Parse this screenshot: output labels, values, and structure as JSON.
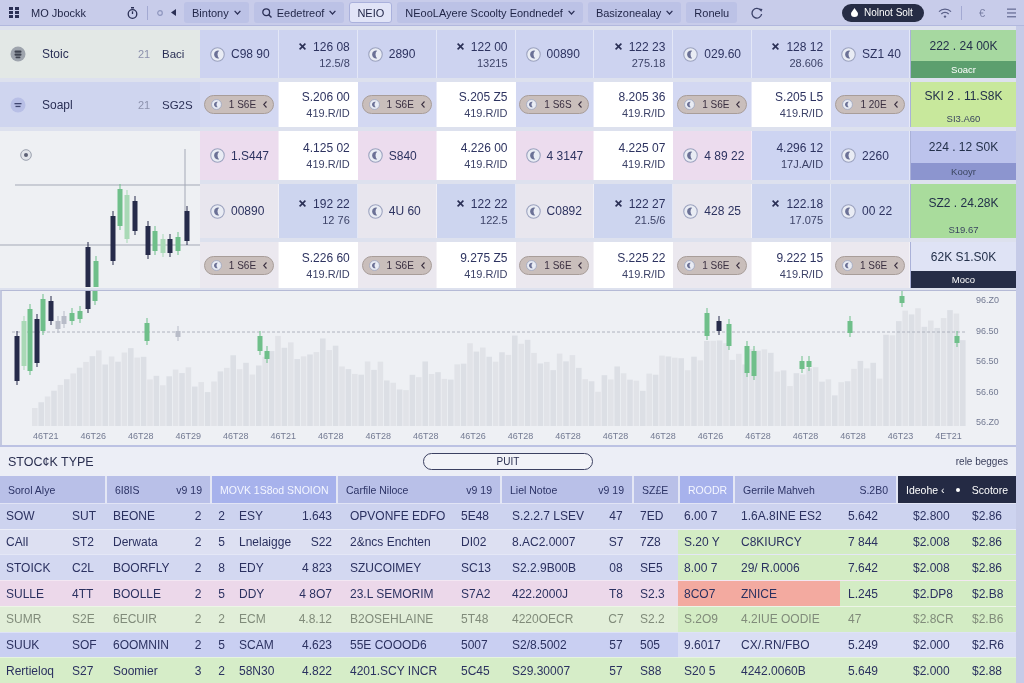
{
  "topbar": {
    "title": "MO Jbockk",
    "tabs": [
      {
        "label": "Bintony",
        "kind": "menu",
        "selected": false
      },
      {
        "label": "Eedetreof",
        "kind": "search",
        "selected": false
      },
      {
        "label": "NEIO",
        "kind": "plain",
        "selected": true
      },
      {
        "label": "NEooLAyere Scoolty Eondnedef",
        "kind": "menu",
        "selected": false
      },
      {
        "label": "Basizonealay",
        "kind": "menu",
        "selected": false
      },
      {
        "label": "Ronelu",
        "kind": "plain",
        "selected": false
      }
    ],
    "action_button": "Nolnot Solt",
    "currency": "€"
  },
  "watchlist": [
    {
      "name": "Stoic",
      "count": "21",
      "value": "Baci",
      "selected": false
    },
    {
      "name": "Soapl",
      "count": "21",
      "value": "SG2S",
      "selected": true
    }
  ],
  "quotes": [
    {
      "color": "#cdd3f0",
      "cells": [
        {
          "kind": "coin",
          "value": "C98 90"
        },
        {
          "kind": "marked",
          "value": "126 08",
          "sub": "12.5/8"
        },
        {
          "kind": "coin",
          "value": "2890"
        },
        {
          "kind": "marked",
          "value": "122 00",
          "sub": "13215"
        },
        {
          "kind": "coin",
          "value": "00890"
        },
        {
          "kind": "marked",
          "value": "122 23",
          "sub": "275.18"
        },
        {
          "kind": "coin",
          "value": "029.60"
        },
        {
          "kind": "marked",
          "value": "128 12",
          "sub": "28.606"
        },
        {
          "kind": "coin",
          "value": "SZ1 40"
        }
      ],
      "summary": {
        "value": "222 . 24 00K",
        "color": "#a6d8a0",
        "note": {
          "text": "Soacr",
          "color": "#5c9f6e"
        }
      }
    },
    {
      "color": "#d3d8f2",
      "cells": [
        {
          "kind": "pill",
          "value": "1 S6E"
        },
        {
          "kind": "price",
          "value": "S.206 00",
          "sub": "419.R/ID",
          "color": "#ffffff"
        },
        {
          "kind": "pill",
          "value": "1 S6E"
        },
        {
          "kind": "price",
          "value": "S.205 Z5",
          "sub": "419.R/ID",
          "color": "#ffffff"
        },
        {
          "kind": "pill",
          "value": "1 S6S"
        },
        {
          "kind": "price",
          "value": "8.205 36",
          "sub": "419.R/ID",
          "color": "#ffffff"
        },
        {
          "kind": "pill",
          "value": "1 S6E"
        },
        {
          "kind": "price",
          "value": "S.205 L5",
          "sub": "419.R/ID",
          "color": "#ffffff"
        },
        {
          "kind": "pill",
          "value": "1 20E"
        }
      ],
      "summary": {
        "value": "SKI 2 . 11.S8K",
        "color": "#c8e89c",
        "note": {
          "text": "SI3.A60",
          "color": "#c8e89c"
        }
      }
    },
    {
      "color": "#ecdcee",
      "cells": [
        {
          "kind": "coin",
          "value": "1.S447"
        },
        {
          "kind": "price",
          "value": "4.125 02",
          "sub": "419.R/ID",
          "color": "#ffffff"
        },
        {
          "kind": "coin",
          "value": "S840"
        },
        {
          "kind": "price",
          "value": "4.226 00",
          "sub": "419.R/ID",
          "color": "#ffffff"
        },
        {
          "kind": "coin",
          "value": "4 3147"
        },
        {
          "kind": "price",
          "value": "4.225 07",
          "sub": "419.R/ID",
          "color": "#ffffff"
        },
        {
          "kind": "coin",
          "value": "4 89 22"
        },
        {
          "kind": "price",
          "value": "4.296 12",
          "sub": "17J.A/ID",
          "color": "#cdd4f2"
        },
        {
          "kind": "coin",
          "value": "2260",
          "color": "#cdd4f2"
        }
      ],
      "summary": {
        "value": "224 . 12 S0K",
        "color": "#bcc3ec",
        "note": {
          "text": "Kooyr",
          "color": "#8c95cf"
        }
      }
    },
    {
      "color": "#e8e6ee",
      "cells": [
        {
          "kind": "coin",
          "value": "00890"
        },
        {
          "kind": "marked",
          "value": "192 22",
          "sub": "12 76",
          "color": "#cdd5ef"
        },
        {
          "kind": "coin",
          "value": "4U 60"
        },
        {
          "kind": "marked",
          "value": "122 22",
          "sub": "122.5",
          "color": "#cdd5ef"
        },
        {
          "kind": "coin",
          "value": "C0892"
        },
        {
          "kind": "marked",
          "value": "122 27",
          "sub": "21.5/6",
          "color": "#cdd5ef"
        },
        {
          "kind": "coin",
          "value": "428 25"
        },
        {
          "kind": "marked",
          "value": "122.18",
          "sub": "17.075",
          "color": "#cdd5ef"
        },
        {
          "kind": "coin",
          "value": "00 22",
          "color": "#cdd5ef"
        }
      ],
      "summary": {
        "value": "SZ2 . 24.28K",
        "color": "#a9dc9c",
        "note": {
          "text": "S19.67",
          "color": "#a9dc9c"
        }
      }
    },
    {
      "color": "#ebe8ef",
      "cells": [
        {
          "kind": "pill",
          "value": "1 S6E"
        },
        {
          "kind": "price",
          "value": "S.226 60",
          "sub": "419.R/ID",
          "color": "#ffffff"
        },
        {
          "kind": "pill",
          "value": "1 S6E"
        },
        {
          "kind": "price",
          "value": "9.275 Z5",
          "sub": "419.R/ID",
          "color": "#ffffff"
        },
        {
          "kind": "pill",
          "value": "1 S6E"
        },
        {
          "kind": "price",
          "value": "S.225 22",
          "sub": "419.R/ID",
          "color": "#ffffff"
        },
        {
          "kind": "pill",
          "value": "1 S6E"
        },
        {
          "kind": "price",
          "value": "9.222 15",
          "sub": "419.R/ID",
          "color": "#ffffff"
        },
        {
          "kind": "pill",
          "value": "1 S6E"
        }
      ],
      "summary": {
        "value": "62K S1.S0K",
        "color": "#dfe3f5",
        "note": {
          "text": "Moco",
          "color": "#262d47"
        }
      }
    }
  ],
  "chart": {
    "y_labels": [
      "96.Z0",
      "96.50",
      "56.50",
      "56.60",
      "56.Z0"
    ],
    "x_labels": [
      "46T21",
      "46T26",
      "46T28",
      "46T29",
      "46T28",
      "46T21",
      "46T28",
      "46T28",
      "46T28",
      "46T26",
      "46T28",
      "46T28",
      "46T28",
      "46T28",
      "46T26",
      "46T28",
      "46T28",
      "46T28",
      "46T23",
      "4ET21"
    ]
  },
  "table": {
    "title": "STOC¢K TYPE",
    "filter_button": "PUIT",
    "note": "rele begges",
    "column_groups": [
      {
        "label": "Sorol Alye",
        "kind": "plain"
      },
      {
        "label": "6I8IS",
        "extra": "v9 19",
        "kind": "plain"
      },
      {
        "label": "MOVK 1S8od SNOION",
        "kind": "accent"
      },
      {
        "label": "Carfile Niloce",
        "extra": "v9 19",
        "kind": "plain"
      },
      {
        "label": "Liel Notoe",
        "extra": "v9 19",
        "kind": "plain"
      },
      {
        "label": "SZ£E",
        "kind": "plain"
      },
      {
        "label": "ROODR",
        "kind": "accent"
      },
      {
        "label": "Gerrile Mahveh",
        "extra": "S.2B0",
        "kind": "plain"
      },
      {
        "label": "Ideohe ‹",
        "extra": "Scotore",
        "kind": "dark"
      }
    ],
    "rows": [
      {
        "color": "#cdd3ef",
        "tail": {
          "color": "#cdd3ef"
        },
        "dimmed": false,
        "cells": [
          "SOW",
          "SUT",
          "BEONE",
          "2",
          "2",
          "ESY",
          "1.643",
          "OPVONFE EDFO",
          "5E48",
          "S.2.2.7 LSEV",
          "47",
          "7ED",
          "6.00 7",
          "1.6A.8INE ES2",
          "5.642",
          "$2.800",
          "$2.86"
        ]
      },
      {
        "color": "#dde0f2",
        "tail": {
          "color": "#d3ecc4"
        },
        "dimmed": false,
        "cells": [
          "CAlI",
          "ST2",
          "Derwata",
          "2",
          "5",
          "Lnelaigge",
          "S22",
          "2&ncs Enchten",
          "DI02",
          "8.AC2.0007",
          "S7",
          "7Z8",
          "S.20 Y",
          "C8KIURCY",
          "7 844",
          "$2.008",
          "$2.86"
        ]
      },
      {
        "color": "#d3d8f1",
        "tail": {
          "color": "#d3ecc4"
        },
        "dimmed": false,
        "cells": [
          "STOICK",
          "C2L",
          "BOORFLY",
          "2",
          "8",
          "EDY",
          "4 823",
          "SZUCOIMEY",
          "SC13",
          "S2.2.9B00B",
          "08",
          "SE5",
          "8.00 7",
          "29/ R.0006",
          "7.642",
          "$2.008",
          "$2.86"
        ]
      },
      {
        "color": "#ecd8ea",
        "tail": {
          "color": "#d3ecc4"
        },
        "dimmed": false,
        "cells": [
          "SULLE",
          "4TT",
          "BOOLLE",
          "2",
          "5",
          "DDY",
          "4 8O7",
          "23.L SEMORIM",
          "S7A2",
          "422.2000J",
          "T8",
          "S2.3",
          {
            "text": "8CO7",
            "color": "#f3aaa0"
          },
          {
            "text": "ZNICE",
            "color": "#f3aaa0"
          },
          "L.245",
          "$2.DP8",
          "$2.B8"
        ]
      },
      {
        "color": "#e1eed8",
        "tail": {
          "color": "#d3ecc4"
        },
        "dimmed": true,
        "cells": [
          "SUMR",
          "S2E",
          "6ECUIR",
          "2",
          "2",
          "ECM",
          "4.8.12",
          "B2OSEHLAINE",
          "5T48",
          "4220OECR",
          "C7",
          "S2.2",
          "S.2O9",
          "4.2IUE OODIE",
          "47",
          "$2.8CR",
          "$2.B6"
        ]
      },
      {
        "color": "#c9cff2",
        "tail": {
          "color": "#dadef4"
        },
        "dimmed": false,
        "cells": [
          "SUUK",
          "SOF",
          "6OOMNIN",
          "2",
          "5",
          "SCAM",
          "4.623",
          "55E COOOD6",
          "5007",
          "S2/8.5002",
          "57",
          "505",
          "9.6017",
          "CX/.RN/FBO",
          "5.249",
          "$2.000",
          "$2.R6"
        ]
      },
      {
        "color": "#d6edc8",
        "tail": {
          "color": "#d6edc8"
        },
        "dimmed": false,
        "cells": [
          "Rertieloq",
          "S27",
          "Soomier",
          "3",
          "2",
          "58N30",
          "4.822",
          "4201.SCY INCR",
          "5C45",
          "S29.30007",
          "57",
          "S88",
          "S20 5",
          "4242.0060B",
          "5.649",
          "$2.000",
          "$2.88"
        ]
      }
    ]
  }
}
